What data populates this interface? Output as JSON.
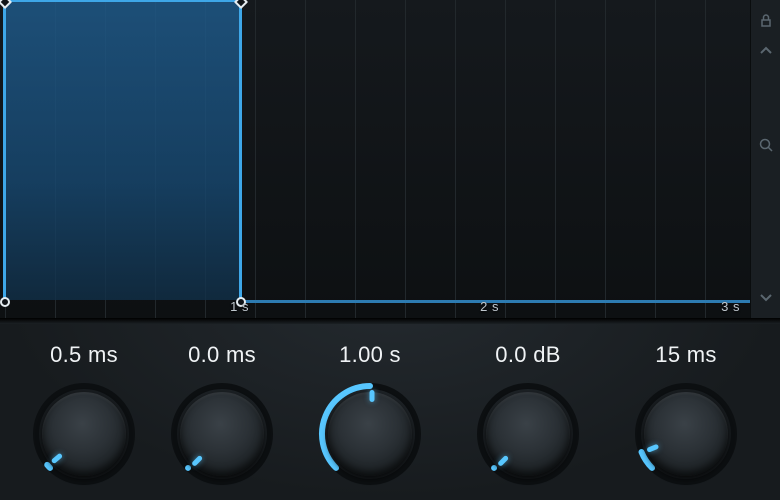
{
  "envelope_graph": {
    "time_ticks": [
      "1 s",
      "2 s",
      "3 s"
    ],
    "handles": {
      "attack_start": true,
      "attack_end": true,
      "release_start": true,
      "release_end": true
    }
  },
  "side_rail": {
    "lock_icon": "lock",
    "up_icon": "chevron-up",
    "zoom_icon": "magnifier",
    "down_icon": "chevron-down"
  },
  "knobs": [
    {
      "label": "0.5 ms",
      "angle": -130,
      "arc_start": -135,
      "arc_end": -130
    },
    {
      "label": "0.0 ms",
      "angle": -135,
      "arc_start": -135,
      "arc_end": -135
    },
    {
      "label": "1.00 s",
      "angle": 0,
      "arc_start": -135,
      "arc_end": 0
    },
    {
      "label": "0.0 dB",
      "angle": -135,
      "arc_start": -135,
      "arc_end": -135
    },
    {
      "label": "15 ms",
      "angle": -112,
      "arc_start": -135,
      "arc_end": -112
    }
  ],
  "colors": {
    "accent": "#58c7ff",
    "envelope": "#3ea7e8"
  }
}
